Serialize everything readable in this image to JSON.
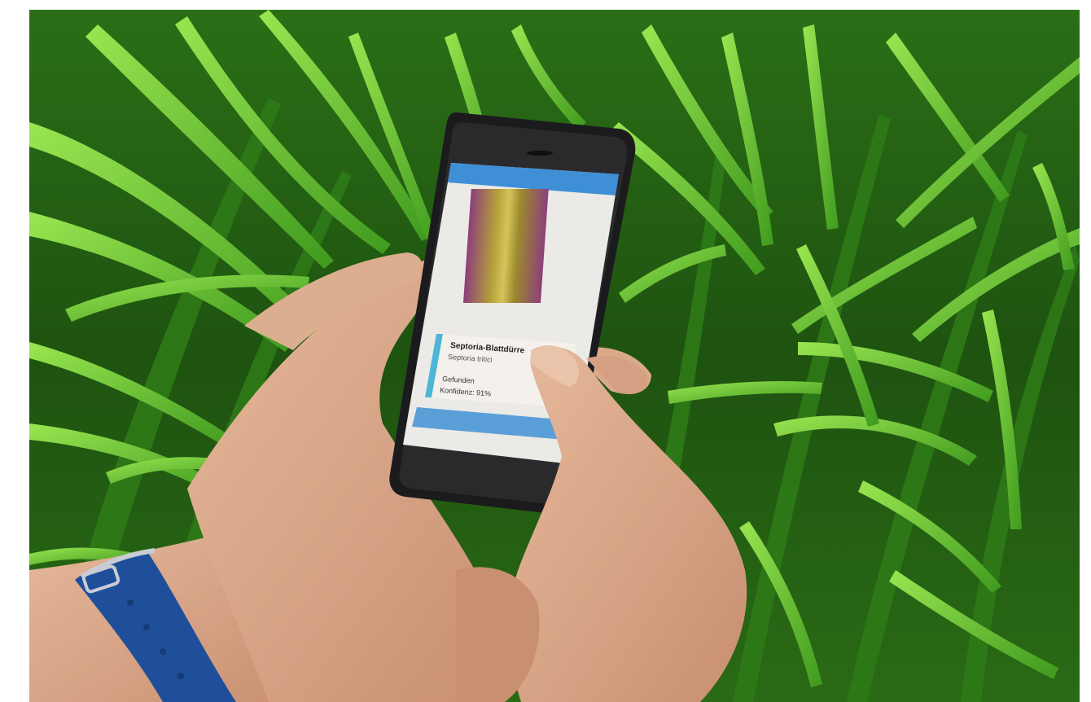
{
  "scene": {
    "status_bar_time": "",
    "app_header": {
      "title": "",
      "right_action": ""
    },
    "result_card": {
      "name_de": "Septoria-Blattdürre",
      "name_latin": "Septoria tritici",
      "found_label": "Gefunden",
      "confidence_label": "Konfidenz: 91%"
    },
    "action_button_label": "",
    "colors": {
      "grass_dark": "#1f5a12",
      "grass_mid": "#3f9a1e",
      "grass_light": "#8ee04a",
      "app_header_blue": "#3f8fd6",
      "button_blue": "#5a9fd8",
      "strap_blue": "#1f4f9a",
      "skin": "#d9a98a"
    }
  }
}
